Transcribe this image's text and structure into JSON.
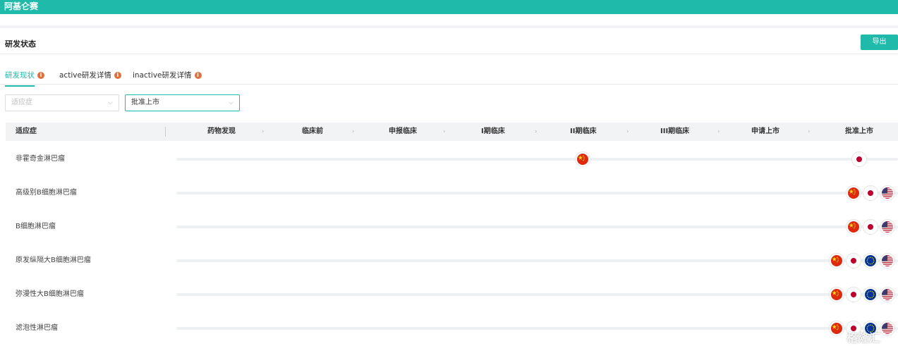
{
  "app": {
    "title": "阿基仑赛"
  },
  "section": {
    "title": "研发状态",
    "export_label": "导出"
  },
  "tabs": [
    {
      "label": "研发现状",
      "active": true
    },
    {
      "label": "active研发详情",
      "active": false
    },
    {
      "label": "inactive研发详情",
      "active": false
    }
  ],
  "filters": {
    "indication_placeholder": "适应症",
    "stage_value": "批准上市"
  },
  "table": {
    "headers": [
      "适应症",
      "药物发现",
      "临床前",
      "申报临床",
      "I期临床",
      "II期临床",
      "III期临床",
      "申请上市",
      "批准上市"
    ],
    "rows": [
      {
        "indication": "非霍奇金淋巴瘤",
        "markers": [
          {
            "stage": "II期临床",
            "regions": [
              "cn-flag-icon"
            ]
          },
          {
            "stage": "批准上市",
            "regions": [
              "jp-flag-icon"
            ]
          }
        ]
      },
      {
        "indication": "高级别B细胞淋巴瘤",
        "markers": [
          {
            "stage": "批准上市",
            "regions": [
              "cn-flag-icon",
              "jp-flag-icon",
              "us-flag-icon"
            ]
          }
        ]
      },
      {
        "indication": "B细胞淋巴瘤",
        "markers": [
          {
            "stage": "批准上市",
            "regions": [
              "cn-flag-icon",
              "jp-flag-icon",
              "us-flag-icon"
            ]
          }
        ]
      },
      {
        "indication": "原发纵隔大B细胞淋巴瘤",
        "markers": [
          {
            "stage": "批准上市",
            "regions": [
              "cn-flag-icon",
              "jp-flag-icon",
              "eu-flag-icon",
              "us-flag-icon"
            ]
          }
        ]
      },
      {
        "indication": "弥漫性大B细胞淋巴瘤",
        "markers": [
          {
            "stage": "批准上市",
            "regions": [
              "cn-flag-icon",
              "jp-flag-icon",
              "eu-flag-icon",
              "us-flag-icon"
            ]
          }
        ]
      },
      {
        "indication": "滤泡性淋巴瘤",
        "markers": [
          {
            "stage": "批准上市",
            "regions": [
              "cn-flag-icon",
              "jp-flag-icon",
              "eu-flag-icon",
              "us-flag-icon"
            ]
          }
        ]
      }
    ]
  },
  "watermark": {
    "text": "格隆汇"
  },
  "colors": {
    "accent": "#1fbaa9",
    "info": "#e06f3a"
  }
}
